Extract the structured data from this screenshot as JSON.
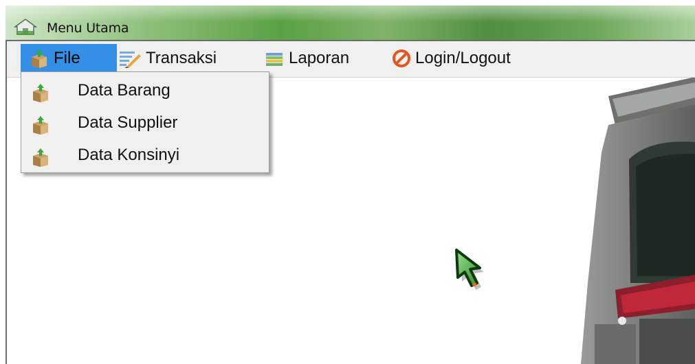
{
  "window": {
    "title": "Menu Utama"
  },
  "menubar": {
    "items": [
      {
        "label": "File",
        "icon": "box-icon",
        "active": true
      },
      {
        "label": "Transaksi",
        "icon": "edit-icon",
        "active": false
      },
      {
        "label": "Laporan",
        "icon": "report-icon",
        "active": false
      },
      {
        "label": "Login/Logout",
        "icon": "no-entry-icon",
        "active": false
      }
    ]
  },
  "file_menu": {
    "items": [
      {
        "label": "Data Barang",
        "icon": "box-icon"
      },
      {
        "label": "Data Supplier",
        "icon": "box-icon"
      },
      {
        "label": "Data Konsinyi",
        "icon": "box-icon"
      }
    ]
  },
  "colors": {
    "menu_highlight": "#3390e6",
    "menu_background": "#f0f0f0",
    "titlebar_green": "#5aa044",
    "sign_red": "#c0283a"
  }
}
